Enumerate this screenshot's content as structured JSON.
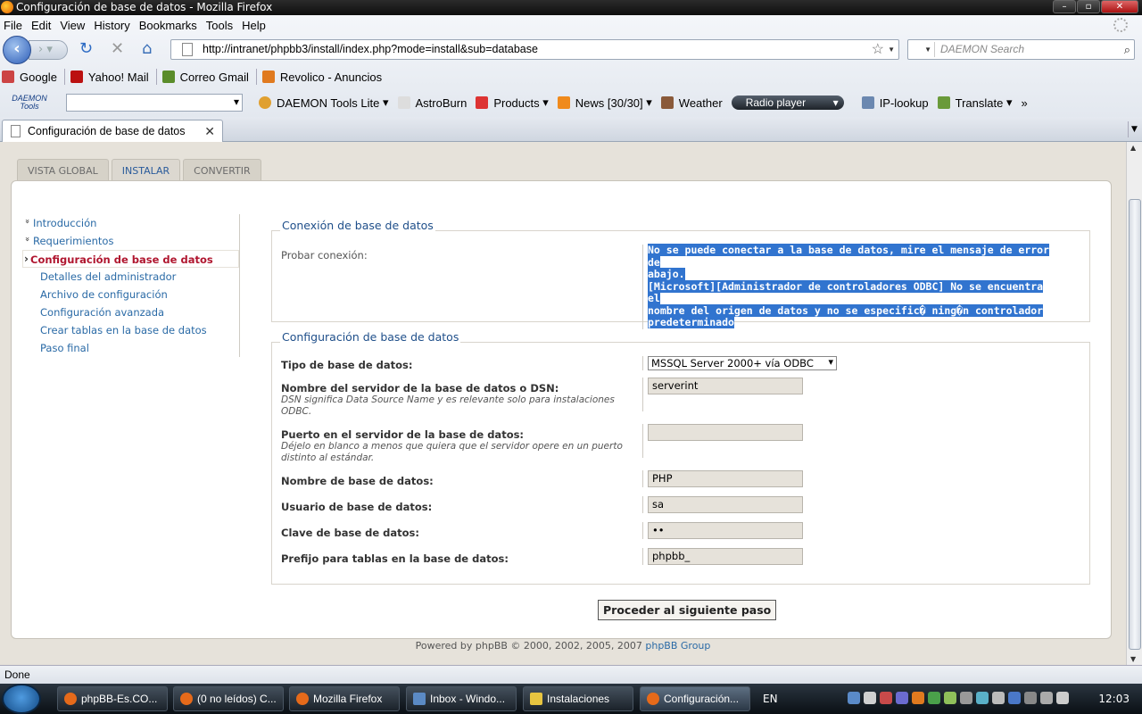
{
  "window": {
    "title": "Configuración de base de datos - Mozilla Firefox"
  },
  "menubar": [
    "File",
    "Edit",
    "View",
    "History",
    "Bookmarks",
    "Tools",
    "Help"
  ],
  "navbar": {
    "url": "http://intranet/phpbb3/install/index.php?mode=install&sub=database",
    "search_placeholder": "DAEMON Search"
  },
  "bookmarks": [
    "Google",
    "Yahoo! Mail",
    "Correo Gmail",
    "Revolico - Anuncios"
  ],
  "toolbar2": {
    "logo": "DAEMON Tools",
    "items": [
      "DAEMON Tools Lite",
      "AstroBurn",
      "Products",
      "News [30/30]",
      "Weather"
    ],
    "radio": "Radio player",
    "items2": [
      "IP-lookup",
      "Translate"
    ]
  },
  "tab": {
    "title": "Configuración de base de datos"
  },
  "phpbb_tabs": [
    "VISTA GLOBAL",
    "INSTALAR",
    "CONVERTIR"
  ],
  "sidenav": [
    "Introducción",
    "Requerimientos",
    "Configuración de base de datos",
    "Detalles del administrador",
    "Archivo de configuración",
    "Configuración avanzada",
    "Crear tablas en la base de datos",
    "Paso final"
  ],
  "connection": {
    "legend": "Conexión de base de datos",
    "label": "Probar conexión:",
    "error_lines": [
      "No se puede conectar a la base de datos, mire el mensaje de error de",
      "abajo.",
      "[Microsoft][Administrador de controladores ODBC] No se encuentra el",
      "nombre del origen de datos y no se especific� ning�n controlador",
      "predeterminado"
    ]
  },
  "config": {
    "legend": "Configuración de base de datos",
    "db_type_label": "Tipo de base de datos:",
    "db_type_value": "MSSQL Server 2000+ vía ODBC",
    "server_label": "Nombre del servidor de la base de datos o DSN:",
    "server_desc": "DSN significa Data Source Name y es relevante solo para instalaciones ODBC.",
    "server_value": "serverint",
    "port_label": "Puerto en el servidor de la base de datos:",
    "port_desc": "Déjelo en blanco a menos que quiera que el servidor opere en un puerto distinto al estándar.",
    "port_value": "",
    "dbname_label": "Nombre de base de datos:",
    "dbname_value": "PHP",
    "user_label": "Usuario de base de datos:",
    "user_value": "sa",
    "pass_label": "Clave de base de datos:",
    "pass_value": "••",
    "prefix_label": "Prefijo para tablas en la base de datos:",
    "prefix_value": "phpbb_"
  },
  "submit_label": "Proceder al siguiente paso",
  "footer": {
    "text": "Powered by phpBB © 2000, 2002, 2005, 2007 ",
    "link": "phpBB Group"
  },
  "status": "Done",
  "taskbar": {
    "buttons": [
      "phpBB-Es.CO...",
      "(0 no leídos) C...",
      "Mozilla Firefox",
      "Inbox - Windo...",
      "Instalaciones",
      "Configuración..."
    ],
    "lang": "EN",
    "clock": "12:03"
  }
}
